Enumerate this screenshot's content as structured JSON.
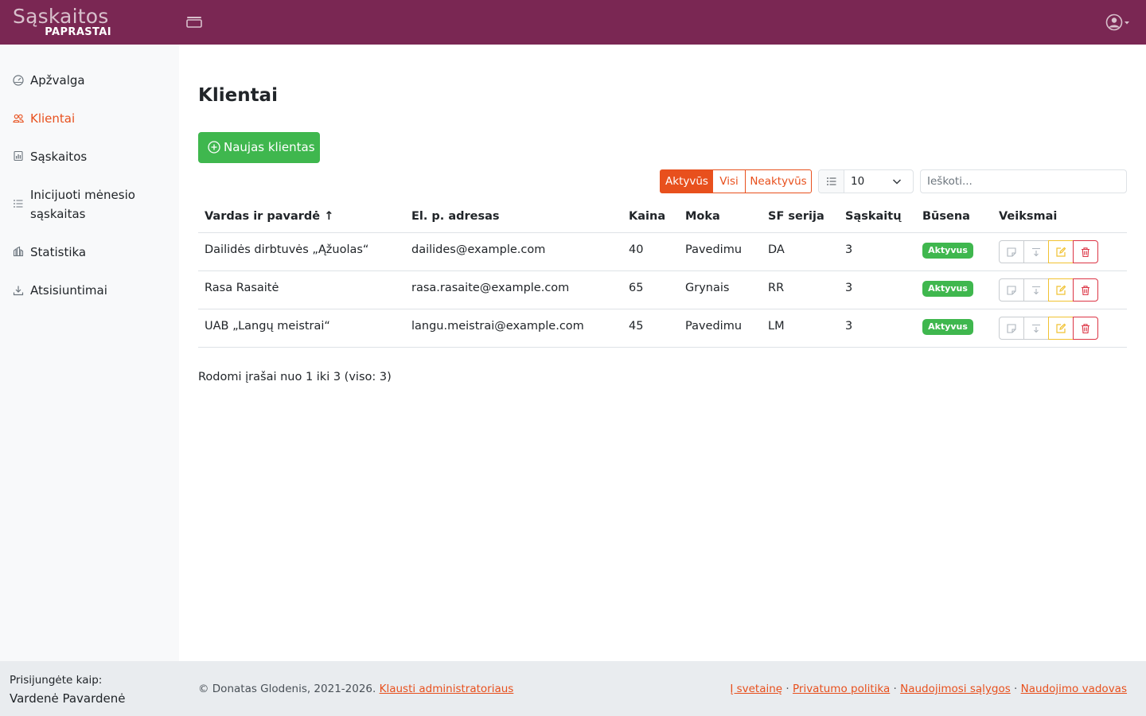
{
  "app": {
    "logo_main": "Sąskaitos",
    "logo_sub": "PAPRASTAI"
  },
  "sidebar": {
    "items": [
      {
        "label": "Apžvalga",
        "icon": "dashboard-icon"
      },
      {
        "label": "Klientai",
        "icon": "people-icon",
        "active": true
      },
      {
        "label": "Sąskaitos",
        "icon": "invoice-icon"
      },
      {
        "label": "Inicijuoti mėnesio sąskaitas",
        "icon": "list-icon"
      },
      {
        "label": "Statistika",
        "icon": "statistics-icon"
      },
      {
        "label": "Atsisiuntimai",
        "icon": "download-icon"
      }
    ]
  },
  "main": {
    "title": "Klientai",
    "new_button": "Naujas klientas",
    "filters": [
      "Aktyvūs",
      "Visi",
      "Neaktyvūs"
    ],
    "active_filter": "Aktyvūs",
    "page_length": "10",
    "search_placeholder": "Ieškoti...",
    "info": "Rodomi įrašai nuo 1 iki 3 (viso: 3)"
  },
  "table": {
    "columns": [
      "Vardas ir pavardė ↑",
      "El. p. adresas",
      "Kaina",
      "Moka",
      "SF serija",
      "Sąskaitų",
      "Būsena",
      "Veiksmai"
    ],
    "rows": [
      {
        "name": "Dailidės dirbtuvės „Ąžuolas“",
        "email": "dailides@example.com",
        "price": "40",
        "payment": "Pavedimu",
        "series": "DA",
        "count": "3",
        "status": "Aktyvus"
      },
      {
        "name": "Rasa Rasaitė",
        "email": "rasa.rasaite@example.com",
        "price": "65",
        "payment": "Grynais",
        "series": "RR",
        "count": "3",
        "status": "Aktyvus"
      },
      {
        "name": "UAB „Langų meistrai“",
        "email": "langu.meistrai@example.com",
        "price": "45",
        "payment": "Pavedimu",
        "series": "LM",
        "count": "3",
        "status": "Aktyvus"
      }
    ]
  },
  "footer": {
    "login_label": "Prisijungėte kaip:",
    "login_name": "Vardenė Pavardenė",
    "copyright": "© Donatas Glodenis, 2021-2026.",
    "contact_link": "Klausti administratoriaus",
    "links": [
      "Į svetainę",
      "Privatumo politika",
      "Naudojimosi sąlygos",
      "Naudojimo vadovas"
    ],
    "separator": " · "
  },
  "colors": {
    "header_bg": "#7a2753",
    "accent": "#e8501d",
    "success": "#3fb74e",
    "warning": "#f1c232",
    "danger": "#dc3545"
  }
}
